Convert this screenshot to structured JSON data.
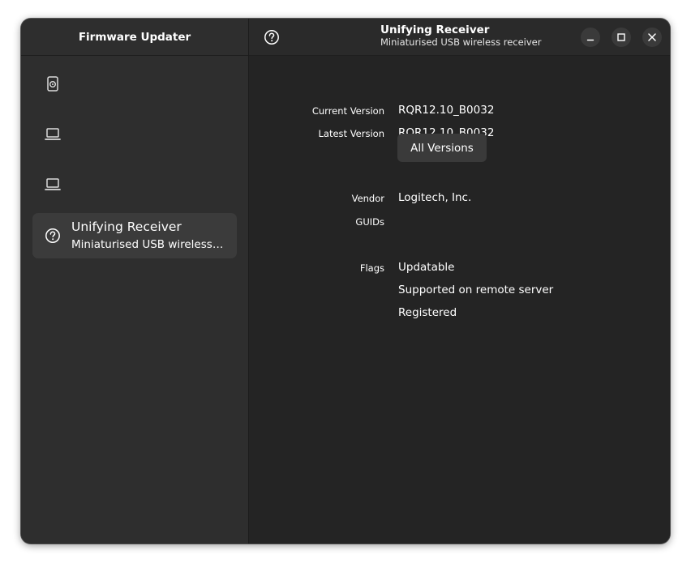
{
  "sidebar": {
    "title": "Firmware Updater",
    "devices": [
      {
        "icon": "drive-icon",
        "name": "",
        "summary": ""
      },
      {
        "icon": "laptop-icon",
        "name": "",
        "summary": ""
      },
      {
        "icon": "laptop-icon",
        "name": "",
        "summary": ""
      },
      {
        "icon": "help-icon",
        "name": "Unifying Receiver",
        "summary": "Miniaturised USB wireless receiver",
        "selected": true
      }
    ]
  },
  "header": {
    "title": "Unifying Receiver",
    "subtitle": "Miniaturised USB wireless receiver",
    "help_icon": "help-icon",
    "window_controls": [
      "minimize-icon",
      "maximize-icon",
      "close-icon"
    ]
  },
  "details": {
    "current_version_label": "Current Version",
    "current_version": "RQR12.10_B0032",
    "latest_version_label": "Latest Version",
    "latest_version": "RQR12.10_B0032",
    "all_versions_button": "All Versions",
    "vendor_label": "Vendor",
    "vendor": "Logitech, Inc.",
    "guids_label": "GUIDs",
    "guids": "",
    "flags_label": "Flags",
    "flags": [
      "Updatable",
      "Supported on remote server",
      "Registered"
    ]
  },
  "colors": {
    "window_bg": "#242424",
    "sidebar_bg": "#2e2e2e",
    "selected_bg": "#3b3b3b",
    "button_bg": "#3a3a3a",
    "text": "#ffffff"
  }
}
